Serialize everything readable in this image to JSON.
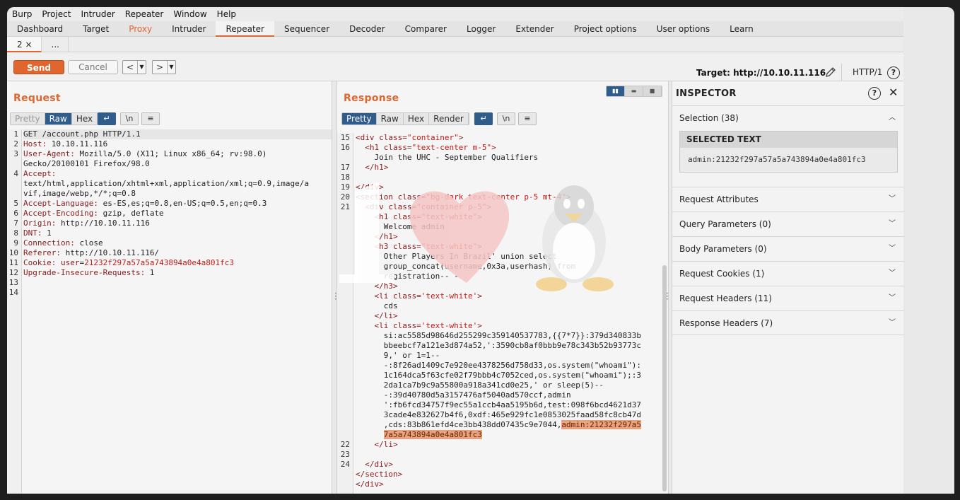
{
  "menu": [
    "Burp",
    "Project",
    "Intruder",
    "Repeater",
    "Window",
    "Help"
  ],
  "main_tabs": [
    "Dashboard",
    "Target",
    "Proxy",
    "Intruder",
    "Repeater",
    "Sequencer",
    "Decoder",
    "Comparer",
    "Logger",
    "Extender",
    "Project options",
    "User options",
    "Learn"
  ],
  "sub_tabs": [
    {
      "label": "2 ×"
    },
    {
      "label": "..."
    }
  ],
  "toolbar": {
    "send": "Send",
    "cancel": "Cancel",
    "back": "<",
    "forward": ">",
    "target": "Target: http://10.10.11.116",
    "protocol": "HTTP/1",
    "help": "?"
  },
  "request": {
    "title": "Request",
    "view_tabs": [
      "Pretty",
      "Raw",
      "Hex"
    ],
    "icon_labels": [
      "↵",
      "\\n",
      "≡"
    ],
    "line_numbers": [
      "1",
      "2",
      "3",
      "",
      "4",
      "",
      "",
      "5",
      "6",
      "7",
      "8",
      "9",
      "10",
      "11",
      "12",
      "13",
      "14"
    ]
  },
  "response": {
    "title": "Response",
    "view_tabs": [
      "Pretty",
      "Raw",
      "Hex",
      "Render"
    ],
    "icon_labels": [
      "↵",
      "\\n",
      "≡"
    ],
    "line_numbers": [
      "15",
      "16",
      "",
      "17",
      "18",
      "19",
      "20",
      "21",
      "",
      "",
      "",
      "",
      "",
      "",
      "",
      "",
      "",
      "",
      "",
      "",
      "",
      "",
      "",
      "",
      "",
      "",
      "",
      "",
      "",
      "",
      "",
      "22",
      "23",
      "24"
    ]
  },
  "inspector": {
    "title": "INSPECTOR",
    "selection_label": "Selection (38)",
    "selected_text_heading": "SELECTED TEXT",
    "selected_text_value": "admin:21232f297a57a5a743894a0e4a801fc3",
    "sections": [
      "Request Attributes",
      "Query Parameters (0)",
      "Body Parameters (0)",
      "Request Cookies (1)",
      "Request Headers (11)",
      "Response Headers (7)"
    ]
  },
  "colors": {
    "accent": "#e0662f",
    "active_blue": "#2f5c8a",
    "highlight": "#e8a27e"
  }
}
